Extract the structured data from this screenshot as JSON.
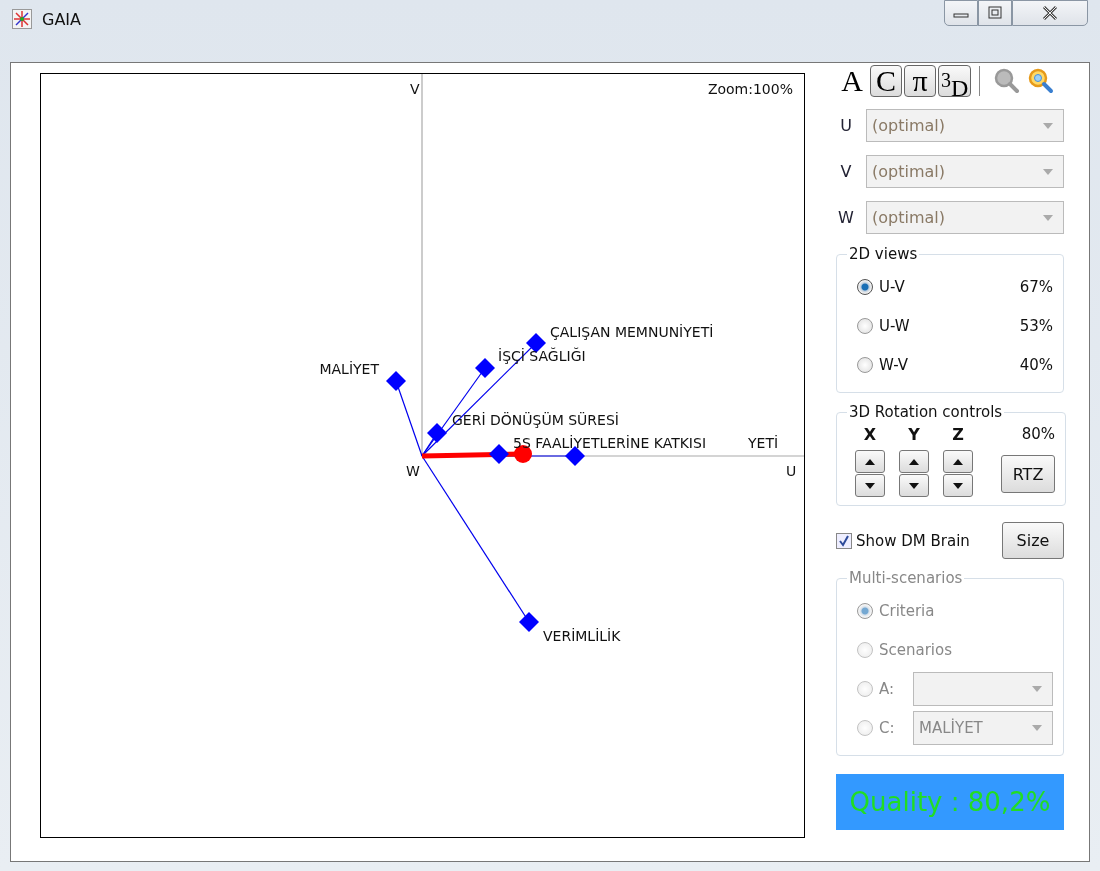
{
  "window": {
    "title": "GAIA"
  },
  "plot": {
    "zoom": "Zoom:100%",
    "axis_labels": {
      "v": "V",
      "w": "W",
      "u": "U"
    },
    "criteria": [
      {
        "name": "MALİYET"
      },
      {
        "name": "İŞÇİ SAĞLIĞI"
      },
      {
        "name": "ÇALIŞAN MEMNUNİYETİ"
      },
      {
        "name": "GERİ DÖNÜŞÜM SÜRESİ"
      },
      {
        "name": "5S FAALİYETLERİNE KATKISI"
      },
      {
        "name": "YETİ"
      },
      {
        "name": "VERİMLİLİK"
      }
    ]
  },
  "toolbar": [
    {
      "label": "A",
      "pressed": false
    },
    {
      "label": "C",
      "pressed": true
    },
    {
      "label": "π",
      "pressed": true
    },
    {
      "label": "$^{3}$D",
      "pressed": true
    }
  ],
  "zoom_tools": [
    {
      "disabled": true
    },
    {
      "disabled": false
    }
  ],
  "axes": [
    {
      "label": "U",
      "value": "(optimal)"
    },
    {
      "label": "V",
      "value": "(optimal)"
    },
    {
      "label": "W",
      "value": "(optimal)"
    }
  ],
  "views": {
    "title": "2D views",
    "options": [
      {
        "label": "U-V",
        "percent": "67%",
        "selected": true
      },
      {
        "label": "U-W",
        "percent": "53%",
        "selected": false
      },
      {
        "label": "W-V",
        "percent": "40%",
        "selected": false
      }
    ]
  },
  "rotation": {
    "title": "3D Rotation controls",
    "axes": [
      "X",
      "Y",
      "Z"
    ],
    "percent": "80%",
    "reset": "RTZ"
  },
  "dm_brain": {
    "label": "Show DM Brain",
    "checked": true,
    "button": "Size"
  },
  "multi": {
    "title": "Multi-scenarios",
    "disabled": true,
    "options": [
      {
        "label": "Criteria",
        "selected": true,
        "kind": "plain"
      },
      {
        "label": "Scenarios",
        "selected": false,
        "kind": "plain"
      },
      {
        "label": "A:",
        "selected": false,
        "kind": "select"
      },
      {
        "label": "C:",
        "selected": false,
        "kind": "select",
        "value": "MALİYET"
      }
    ]
  },
  "quality": "Quality : 80,2%"
}
